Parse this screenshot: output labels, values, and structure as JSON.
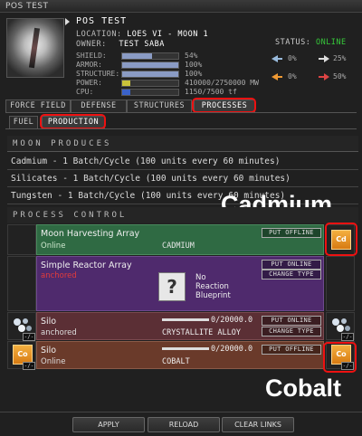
{
  "window": {
    "title": "POS TEST"
  },
  "header": {
    "name": "POS TEST",
    "location_label": "LOCATION:",
    "location_value": "LOES VI - MOON 1",
    "owner_label": "OWNER:",
    "owner_value": "TEST SABA",
    "status_label": "STATUS:",
    "status_value": "ONLINE",
    "stats": [
      {
        "label": "SHIELD:",
        "value": "54%",
        "fill": 0.54,
        "color": "#8a9bc4"
      },
      {
        "label": "ARMOR:",
        "value": "100%",
        "fill": 1.0,
        "color": "#8a9bc4"
      },
      {
        "label": "STRUCTURE:",
        "value": "100%",
        "fill": 1.0,
        "color": "#8a9bc4"
      },
      {
        "label": "POWER:",
        "value": "410000/2750000 MW",
        "fill": 0.149,
        "color": "#c9c23a"
      },
      {
        "label": "CPU:",
        "value": "1150/7500 tf",
        "fill": 0.153,
        "color": "#3a62c9"
      }
    ],
    "resists": [
      {
        "icon": "em-resist-icon",
        "value": "0%"
      },
      {
        "icon": "thermal-resist-icon",
        "value": "25%"
      },
      {
        "icon": "kinetic-resist-icon",
        "value": "0%"
      },
      {
        "icon": "explosive-resist-icon",
        "value": "50%"
      }
    ]
  },
  "tabs": [
    "FORCE FIELD",
    "DEFENSE",
    "STRUCTURES",
    "PROCESSES"
  ],
  "active_tab": "PROCESSES",
  "subtabs": [
    "FUEL",
    "PRODUCTION"
  ],
  "active_subtab": "PRODUCTION",
  "moon_produces": {
    "heading": "MOON PRODUCES",
    "items": [
      "Cadmium - 1 Batch/Cycle (100 units every 60 minutes)",
      "Silicates - 1 Batch/Cycle (100 units every 60 minutes)",
      "Tungsten - 1 Batch/Cycle (100 units every 60 minutes)"
    ]
  },
  "process_control": {
    "heading": "PROCESS CONTROL",
    "rows": [
      {
        "name": "Moon Harvesting Array",
        "status": "Online",
        "product": "CADMIUM",
        "buttons": [
          "PUT OFFLINE"
        ],
        "color": "#2f6a43",
        "right_icon": "Cd"
      },
      {
        "name": "Simple Reactor Array",
        "status": "anchored",
        "buttons": [
          "PUT ONLINE",
          "CHANGE TYPE"
        ],
        "color": "#4f2a6d",
        "no_blueprint": [
          "No",
          "Reaction",
          "Blueprint"
        ],
        "blueprint_glyph": "?"
      },
      {
        "name": "Silo",
        "status": "anchored",
        "amount": "0/20000.0",
        "product": "CRYSTALLITE ALLOY",
        "buttons": [
          "PUT ONLINE",
          "CHANGE TYPE"
        ],
        "color": "#5b2f35"
      },
      {
        "name": "Silo",
        "status": "Online",
        "amount": "0/20000.0",
        "product": "COBALT",
        "buttons": [
          "PUT OFFLINE"
        ],
        "color": "#6a3a2a",
        "left_icon": "Co",
        "right_icon": "Co"
      }
    ],
    "small_tag": "-/-"
  },
  "annotations": {
    "top": "Cadmium",
    "bottom": "Cobalt"
  },
  "footer_buttons": [
    "APPLY",
    "RELOAD",
    "CLEAR LINKS"
  ]
}
